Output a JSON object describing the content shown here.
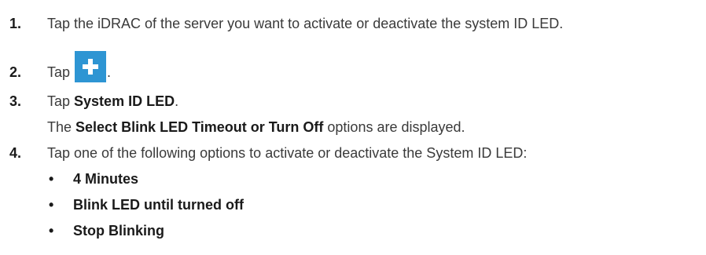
{
  "steps": [
    {
      "number": "1.",
      "text": "Tap the iDRAC of the server you want to activate or deactivate the system ID LED."
    },
    {
      "number": "2.",
      "text_before": "Tap",
      "text_after": ".",
      "icon": "plus-icon",
      "icon_color": "#2e95d3"
    },
    {
      "number": "3.",
      "text_before": "Tap ",
      "bold": "System ID LED",
      "text_after": "."
    },
    {
      "continuation_before": "The ",
      "continuation_bold": "Select Blink LED Timeout or Turn Off",
      "continuation_after": " options are displayed."
    },
    {
      "number": "4.",
      "text": "Tap one of the following options to activate or deactivate the System ID LED:"
    }
  ],
  "options": [
    {
      "bullet": "•",
      "label": "4 Minutes"
    },
    {
      "bullet": "•",
      "label": "Blink LED until turned off"
    },
    {
      "bullet": "•",
      "label": "Stop Blinking"
    }
  ]
}
